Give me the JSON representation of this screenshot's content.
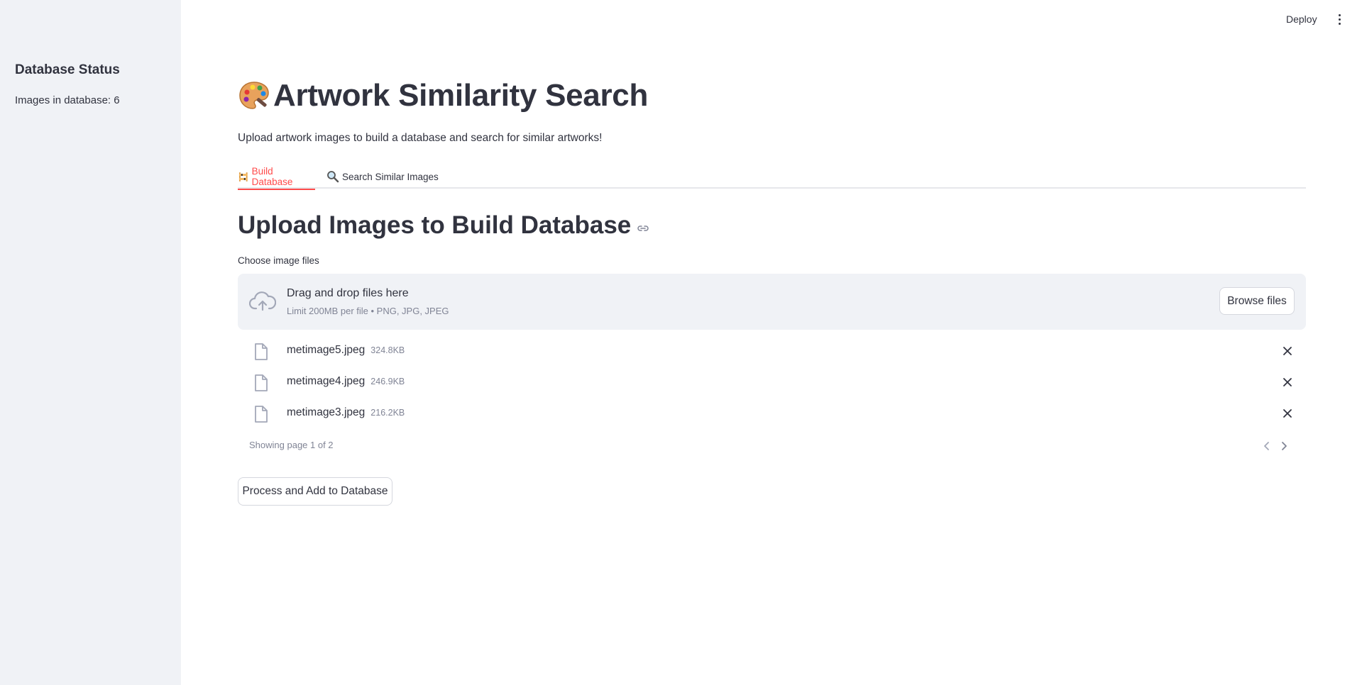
{
  "sidebar": {
    "title": "Database Status",
    "count_text": "Images in database: 6"
  },
  "header": {
    "deploy_label": "Deploy",
    "menu_icon": "kebab-menu-icon"
  },
  "main": {
    "title": "Artwork Similarity Search",
    "title_icon": "palette-icon",
    "subtitle": "Upload artwork images to build a database and search for similar artworks!",
    "tabs": [
      {
        "label": "Build Database",
        "icon": "construction-icon",
        "active": true
      },
      {
        "label": "Search Similar Images",
        "icon": "magnifier-icon",
        "active": false
      }
    ],
    "section_title": "Upload Images to Build Database",
    "file_uploader": {
      "label": "Choose image files",
      "drop_title": "Drag and drop files here",
      "drop_limit": "Limit 200MB per file • PNG, JPG, JPEG",
      "browse_label": "Browse files",
      "files": [
        {
          "name": "metimage5.jpeg",
          "size": "324.8KB"
        },
        {
          "name": "metimage4.jpeg",
          "size": "246.9KB"
        },
        {
          "name": "metimage3.jpeg",
          "size": "216.2KB"
        }
      ],
      "pager_text": "Showing page 1 of 2"
    },
    "process_button": "Process and Add to Database"
  },
  "colors": {
    "accent": "#ff4b4b",
    "sidebar_bg": "#f0f2f6",
    "text": "#31333f",
    "muted": "#808495"
  }
}
